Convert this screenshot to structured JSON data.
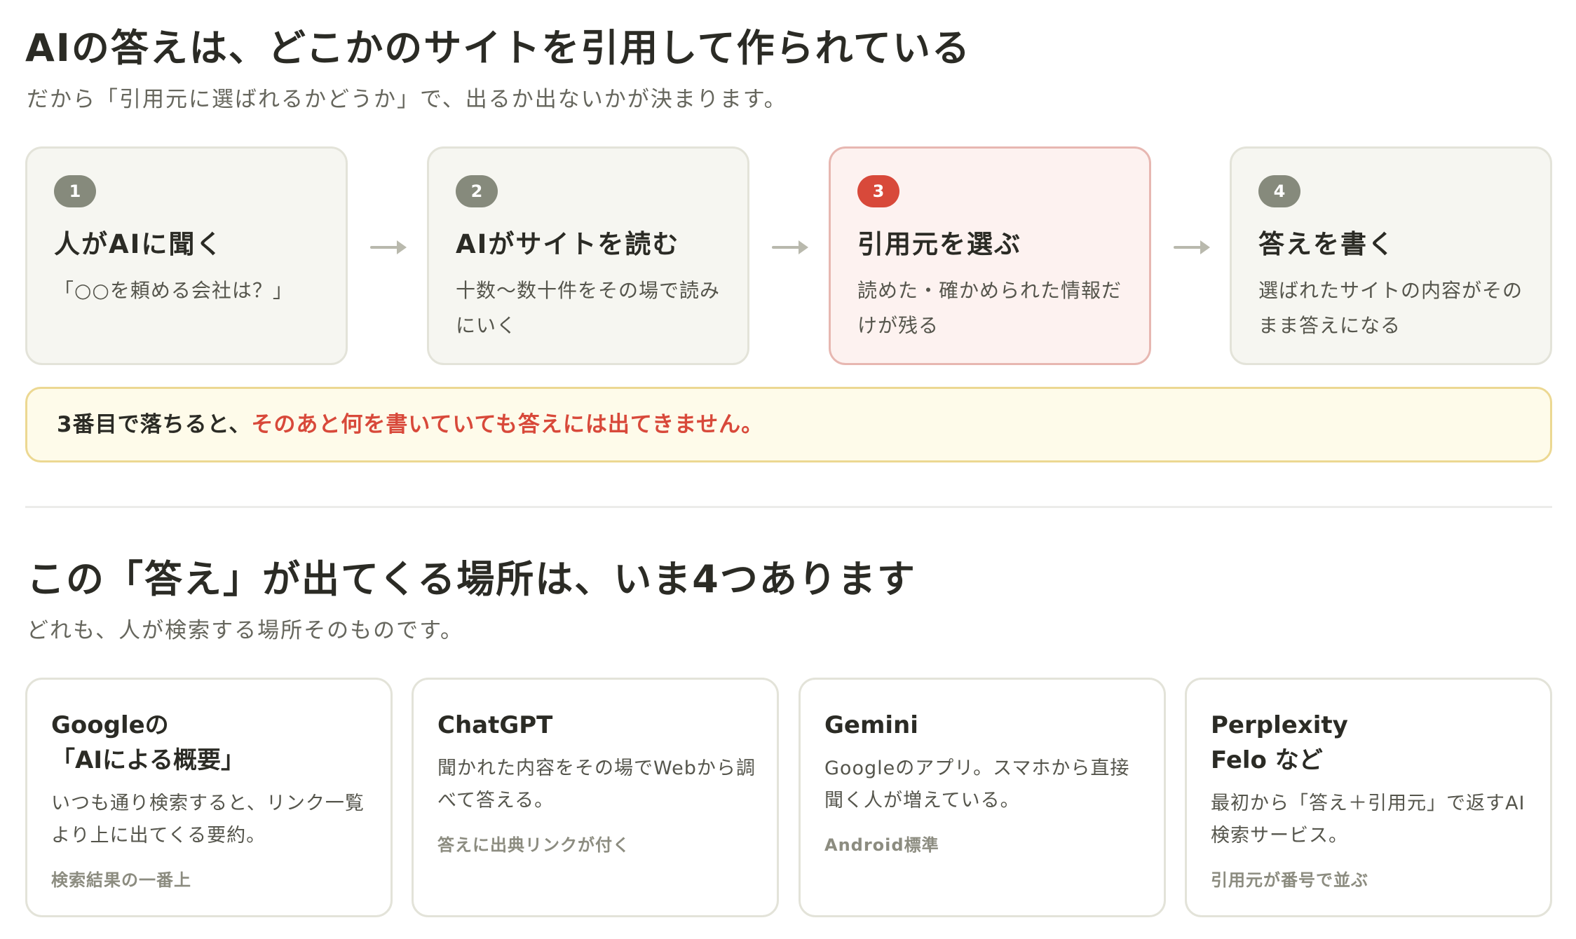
{
  "section1": {
    "title": "AIの答えは、どこかのサイトを引用して作られている",
    "subtitle": "だから「引用元に選ばれるかどうか」で、出るか出ないかが決まります。",
    "steps": [
      {
        "number": "1",
        "title": "人がAIに聞く",
        "desc": "「○○を頼める会社は？」"
      },
      {
        "number": "2",
        "title": "AIがサイトを読む",
        "desc": "十数〜数十件をその場で読みにいく"
      },
      {
        "number": "3",
        "title": "引用元を選ぶ",
        "desc": "読めた・確かめられた情報だけが残る"
      },
      {
        "number": "4",
        "title": "答えを書く",
        "desc": "選ばれたサイトの内容がそのまま答えになる"
      }
    ],
    "callout": {
      "plain": "3番目で落ちると、",
      "emphasis": "そのあと何を書いていても答えには出てきません。"
    }
  },
  "section2": {
    "title": "この「答え」が出てくる場所は、いま4つあります",
    "subtitle": "どれも、人が検索する場所そのものです。",
    "cards": [
      {
        "title_line1": "Googleの",
        "title_line2": "「AIによる概要」",
        "desc": "いつも通り検索すると、リンク一覧より上に出てくる要約。",
        "note": "検索結果の一番上"
      },
      {
        "title_line1": "ChatGPT",
        "title_line2": "",
        "desc": "聞かれた内容をその場でWebから調べて答える。",
        "note": "答えに出典リンクが付く"
      },
      {
        "title_line1": "Gemini",
        "title_line2": "",
        "desc": "Googleのアプリ。スマホから直接聞く人が増えている。",
        "note": "Android標準"
      },
      {
        "title_line1": "Perplexity",
        "title_line2": "Felo など",
        "desc": "最初から「答え＋引用元」で返すAI検索サービス。",
        "note": "引用元が番号で並ぶ"
      }
    ]
  },
  "colors": {
    "accent_red": "#d8493a",
    "badge_gray": "#868a7c",
    "callout_border": "#ecd892",
    "highlight_bg": "#fdf2f0"
  }
}
